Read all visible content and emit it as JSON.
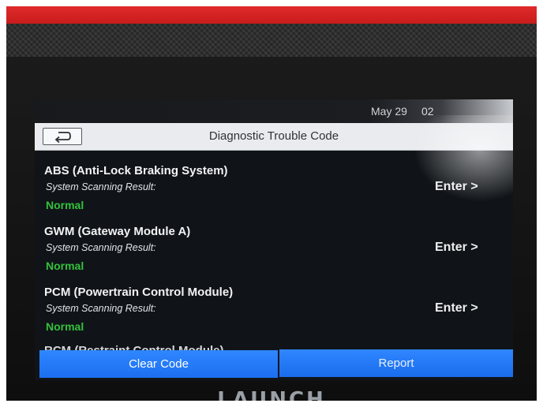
{
  "status_bar": {
    "date": "May 29",
    "time": "02"
  },
  "title_bar": {
    "title": "Diagnostic Trouble Code"
  },
  "modules": [
    {
      "name": "ABS (Anti-Lock Braking System)",
      "result_label": "System Scanning Result:",
      "result_value": "Normal",
      "enter_label": "Enter >"
    },
    {
      "name": "GWM (Gateway Module A)",
      "result_label": "System Scanning Result:",
      "result_value": "Normal",
      "enter_label": "Enter >"
    },
    {
      "name": "PCM (Powertrain Control Module)",
      "result_label": "System Scanning Result:",
      "result_value": "Normal",
      "enter_label": "Enter >"
    }
  ],
  "partial_module": {
    "name": "RCM (Restraint Control Module)"
  },
  "footer": {
    "clear_label": "Clear Code",
    "report_label": "Report"
  },
  "device": {
    "brand": "LAUNCH"
  },
  "colors": {
    "accent": "#1f74f5",
    "normal": "#34c13c",
    "device_red": "#d62424"
  }
}
